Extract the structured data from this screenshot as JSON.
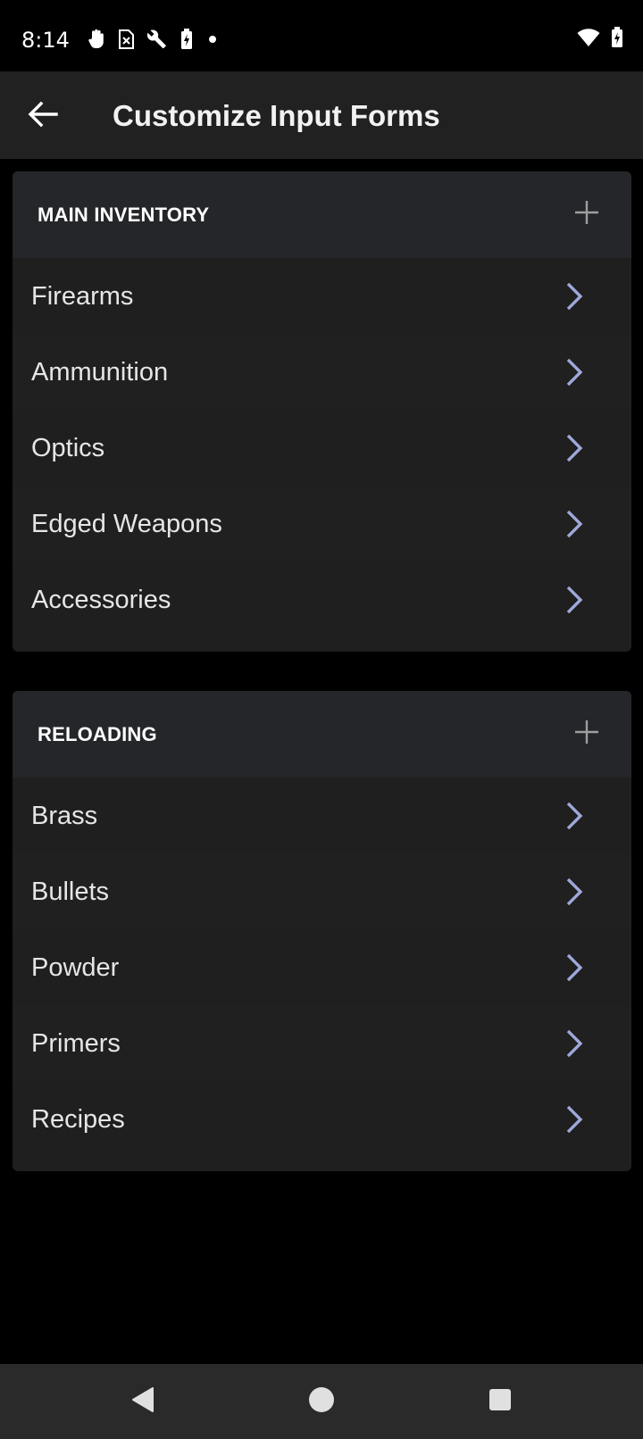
{
  "status_bar": {
    "time": "8:14",
    "left_icons": [
      "hand-icon",
      "sim-card-icon",
      "wrench-icon",
      "battery-saver-icon",
      "dot-icon"
    ],
    "right_icons": [
      "wifi-icon",
      "battery-icon"
    ]
  },
  "app_bar": {
    "title": "Customize Input Forms",
    "back_icon": "arrow-left-icon"
  },
  "sections": [
    {
      "title": "MAIN INVENTORY",
      "items": [
        "Firearms",
        "Ammunition",
        "Optics",
        "Edged Weapons",
        "Accessories"
      ]
    },
    {
      "title": "RELOADING",
      "items": [
        "Brass",
        "Bullets",
        "Powder",
        "Primers",
        "Recipes"
      ]
    }
  ],
  "colors": {
    "background": "#000000",
    "app_bar": "#212121",
    "card": "#1f1f1f",
    "card_header": "#25262a",
    "chevron": "#9fa8da",
    "add_icon": "#9e9e9e"
  },
  "nav_bar": {
    "icons": [
      "back-triangle-icon",
      "home-circle-icon",
      "recents-square-icon"
    ]
  }
}
